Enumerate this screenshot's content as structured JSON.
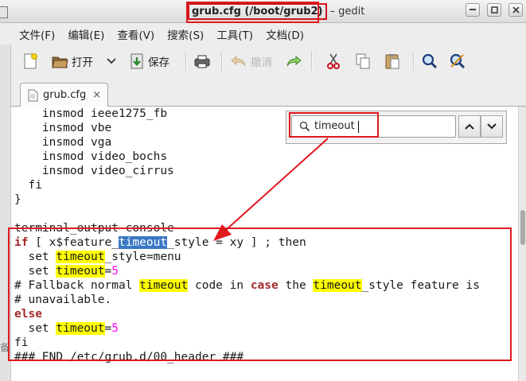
{
  "window": {
    "title_file": "grub.cfg (/boot/grub2)",
    "title_app": "– gedit",
    "buttons": [
      "minimize",
      "maximize",
      "close"
    ]
  },
  "menubar": {
    "items": [
      "文件(F)",
      "编辑(E)",
      "查看(V)",
      "搜索(S)",
      "工具(T)",
      "文档(D)"
    ]
  },
  "toolbar": {
    "new_icon": "new-document-icon",
    "open_label": "打开",
    "save_label": "保存",
    "undo_label": "撤消"
  },
  "tabs": [
    {
      "label": "grub.cfg",
      "close": "×"
    }
  ],
  "search": {
    "value": "timeout",
    "icon": "search-icon"
  },
  "colors": {
    "keyword": "#a52a2a",
    "number": "#ff00ff",
    "highlight": "#ffff00",
    "current_match": "#3a78c4",
    "annotation": "#e0181e"
  },
  "stray_text": "备",
  "code": {
    "lines": [
      [
        {
          "t": "    insmod ieee1275_fb"
        }
      ],
      [
        {
          "t": "    insmod vbe"
        }
      ],
      [
        {
          "t": "    insmod vga"
        }
      ],
      [
        {
          "t": "    insmod video_bochs"
        }
      ],
      [
        {
          "t": "    insmod video_cirrus"
        }
      ],
      [
        {
          "t": "  fi"
        }
      ],
      [
        {
          "t": "}"
        }
      ],
      [
        {
          "t": ""
        }
      ],
      [
        {
          "t": "terminal_output console"
        }
      ],
      [
        {
          "t": "if",
          "c": "kw"
        },
        {
          "t": " [ x$feature_"
        },
        {
          "t": "timeout",
          "c": "cur"
        },
        {
          "t": "_style = xy ] ; then"
        }
      ],
      [
        {
          "t": "  set "
        },
        {
          "t": "timeout",
          "c": "hl"
        },
        {
          "t": "_style=menu"
        }
      ],
      [
        {
          "t": "  set "
        },
        {
          "t": "timeout",
          "c": "hl"
        },
        {
          "t": "="
        },
        {
          "t": "5",
          "c": "num"
        }
      ],
      [
        {
          "t": "# Fallback normal "
        },
        {
          "t": "timeout",
          "c": "hl"
        },
        {
          "t": " code in "
        },
        {
          "t": "case",
          "c": "kw"
        },
        {
          "t": " the "
        },
        {
          "t": "timeout",
          "c": "hl"
        },
        {
          "t": "_style feature is"
        }
      ],
      [
        {
          "t": "# unavailable."
        }
      ],
      [
        {
          "t": "else",
          "c": "kw"
        }
      ],
      [
        {
          "t": "  set "
        },
        {
          "t": "timeout",
          "c": "hl"
        },
        {
          "t": "="
        },
        {
          "t": "5",
          "c": "num"
        }
      ],
      [
        {
          "t": "fi"
        }
      ],
      [
        {
          "t": "### END /etc/grub.d/00_header ###"
        }
      ]
    ]
  }
}
